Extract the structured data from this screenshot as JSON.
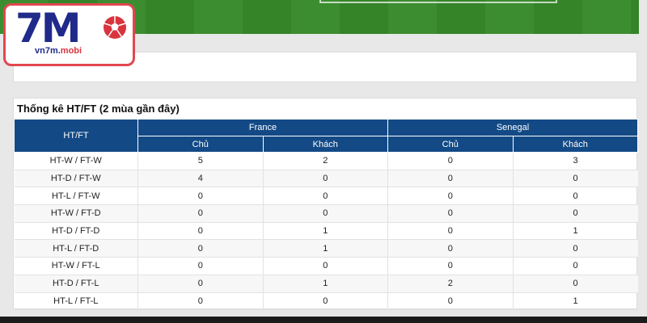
{
  "logo": {
    "mark": "7M",
    "domain_main": "vn7m.",
    "domain_accent": "mobi",
    "colors": {
      "frame": "#e1474f",
      "text": "#1f2a8a"
    }
  },
  "stats": {
    "title": "Thống kê HT/FT (2 mùa gần đây)",
    "header": {
      "label_col": "HT/FT",
      "team1": "France",
      "team2": "Senegal",
      "home": "Chủ",
      "away": "Khách"
    },
    "rows": [
      {
        "label": "HT-W / FT-W",
        "v": [
          "5",
          "2",
          "0",
          "3"
        ]
      },
      {
        "label": "HT-D / FT-W",
        "v": [
          "4",
          "0",
          "0",
          "0"
        ]
      },
      {
        "label": "HT-L / FT-W",
        "v": [
          "0",
          "0",
          "0",
          "0"
        ]
      },
      {
        "label": "HT-W / FT-D",
        "v": [
          "0",
          "0",
          "0",
          "0"
        ]
      },
      {
        "label": "HT-D / FT-D",
        "v": [
          "0",
          "1",
          "0",
          "1"
        ]
      },
      {
        "label": "HT-L / FT-D",
        "v": [
          "0",
          "1",
          "0",
          "0"
        ]
      },
      {
        "label": "HT-W / FT-L",
        "v": [
          "0",
          "0",
          "0",
          "0"
        ]
      },
      {
        "label": "HT-D / FT-L",
        "v": [
          "0",
          "1",
          "2",
          "0"
        ]
      },
      {
        "label": "HT-L / FT-L",
        "v": [
          "0",
          "0",
          "0",
          "1"
        ]
      }
    ],
    "colors": {
      "header_bg": "#134a86"
    }
  }
}
